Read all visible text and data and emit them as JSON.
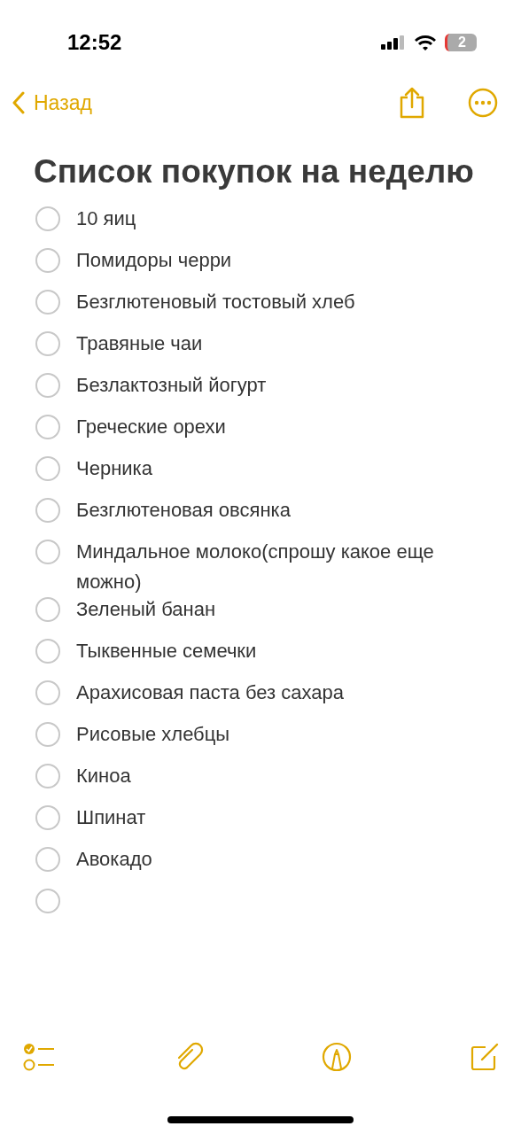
{
  "status_bar": {
    "time": "12:52",
    "battery": "2"
  },
  "nav": {
    "back": "Назад"
  },
  "note": {
    "title": "Список покупок на неделю",
    "checklist": [
      {
        "text": "10 яиц",
        "checked": false
      },
      {
        "text": "Помидоры черри",
        "checked": false
      },
      {
        "text": "Безглютеновый тостовый хлеб",
        "checked": false
      },
      {
        "text": "Травяные чаи",
        "checked": false
      },
      {
        "text": "Безлактозный йогурт",
        "checked": false
      },
      {
        "text": "Греческие орехи",
        "checked": false
      },
      {
        "text": "Черника",
        "checked": false
      },
      {
        "text": "Безглютеновая овсянка",
        "checked": false
      },
      {
        "text": "Миндальное молоко(спрошу какое еще можно)",
        "checked": false
      },
      {
        "text": "Зеленый банан",
        "checked": false
      },
      {
        "text": "Тыквенные семечки",
        "checked": false
      },
      {
        "text": "Арахисовая паста без сахара",
        "checked": false
      },
      {
        "text": "Рисовые хлебцы",
        "checked": false
      },
      {
        "text": "Киноа",
        "checked": false
      },
      {
        "text": "Шпинат",
        "checked": false
      },
      {
        "text": "Авокадо",
        "checked": false
      },
      {
        "checked": false
      }
    ]
  }
}
